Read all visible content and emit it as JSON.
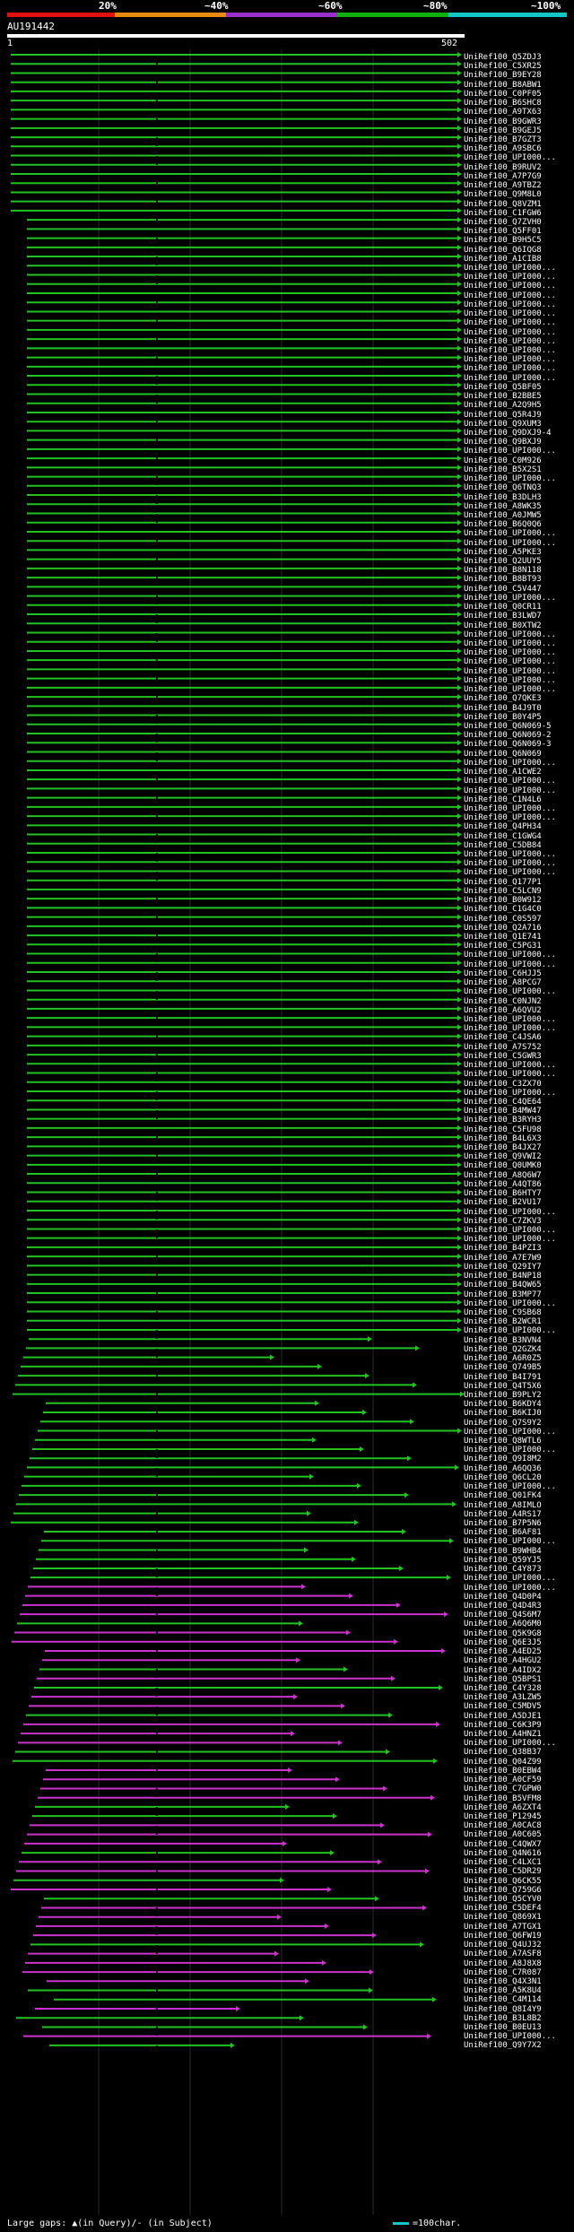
{
  "legend": {
    "ticks": [
      "20%",
      "~40%",
      "~60%",
      "~80%",
      "~100%"
    ],
    "colors": [
      "#e01010",
      "#e88a10",
      "#9930cc",
      "#11b011",
      "#12c6c6"
    ]
  },
  "query": {
    "name": "AU191442",
    "start": "1",
    "end": "502"
  },
  "colors": {
    "green": "#22c322",
    "magenta": "#cc33cc",
    "grid": "#2a2a2a",
    "centerline": "#000000"
  },
  "footer": {
    "gaps_text": "Large gaps: ▲(in Query)/- (in Subject)",
    "scale_text": "=100char."
  },
  "hits": [
    "UniRef100_Q5ZDJ3",
    "UniRef100_C5XR25",
    "UniRef100_B9EY28",
    "UniRef100_B8ABW1",
    "UniRef100_C0PF05",
    "UniRef100_B6SHC8",
    "UniRef100_A9TX63",
    "UniRef100_B9GWR3",
    "UniRef100_B9GEJ5",
    "UniRef100_B7GZT3",
    "UniRef100_A9SBC6",
    "UniRef100_UPI000...",
    "UniRef100_B9RUV2",
    "UniRef100_A7P7G9",
    "UniRef100_A9TBZ2",
    "UniRef100_Q9M8L0",
    "UniRef100_Q8VZM1",
    "UniRef100_C1FGW6",
    "UniRef100_Q7ZVH0",
    "UniRef100_Q5FF01",
    "UniRef100_B9H5C5",
    "UniRef100_Q6IQG8",
    "UniRef100_A1CIB8",
    "UniRef100_UPI000...",
    "UniRef100_UPI000...",
    "UniRef100_UPI000...",
    "UniRef100_UPI000...",
    "UniRef100_UPI000...",
    "UniRef100_UPI000...",
    "UniRef100_UPI000...",
    "UniRef100_UPI000...",
    "UniRef100_UPI000...",
    "UniRef100_UPI000...",
    "UniRef100_UPI000...",
    "UniRef100_UPI000...",
    "UniRef100_UPI000...",
    "UniRef100_Q5BF05",
    "UniRef100_B2BBE5",
    "UniRef100_A2Q9H5",
    "UniRef100_Q5R4J9",
    "UniRef100_Q9XUM3",
    "UniRef100_Q9DXJ9-4",
    "UniRef100_Q9BXJ9",
    "UniRef100_UPI000...",
    "UniRef100_C0M926",
    "UniRef100_B5X2S1",
    "UniRef100_UPI000...",
    "UniRef100_Q6TNQ3",
    "UniRef100_B3DLH3",
    "UniRef100_A8WK35",
    "UniRef100_A0JMW5",
    "UniRef100_B6Q0Q6",
    "UniRef100_UPI000...",
    "UniRef100_UPI000...",
    "UniRef100_A5PKE3",
    "UniRef100_Q2UUY5",
    "UniRef100_B8N118",
    "UniRef100_B8BT93",
    "UniRef100_C5V447",
    "UniRef100_UPI000...",
    "UniRef100_Q0CR11",
    "UniRef100_B3LWD7",
    "UniRef100_B0XTW2",
    "UniRef100_UPI000...",
    "UniRef100_UPI000...",
    "UniRef100_UPI000...",
    "UniRef100_UPI000...",
    "UniRef100_UPI000...",
    "UniRef100_UPI000...",
    "UniRef100_UPI000...",
    "UniRef100_Q7QKE3",
    "UniRef100_B4J9T0",
    "UniRef100_B0Y4P5",
    "UniRef100_Q6N069-5",
    "UniRef100_Q6N069-2",
    "UniRef100_Q6N069-3",
    "UniRef100_Q6N069",
    "UniRef100_UPI000...",
    "UniRef100_A1CWE2",
    "UniRef100_UPI000...",
    "UniRef100_UPI000...",
    "UniRef100_C1N4L6",
    "UniRef100_UPI000...",
    "UniRef100_UPI000...",
    "UniRef100_Q4PH34",
    "UniRef100_C1GWG4",
    "UniRef100_C5DB84",
    "UniRef100_UPI000...",
    "UniRef100_UPI000...",
    "UniRef100_UPI000...",
    "UniRef100_Q177P1",
    "UniRef100_C5LCN9",
    "UniRef100_B0W912",
    "UniRef100_C1G4C0",
    "UniRef100_C0S597",
    "UniRef100_Q2A716",
    "UniRef100_Q1E741",
    "UniRef100_C5PG31",
    "UniRef100_UPI000...",
    "UniRef100_UPI000...",
    "UniRef100_C6HJJ5",
    "UniRef100_A8PCG7",
    "UniRef100_UPI000...",
    "UniRef100_C0NJN2",
    "UniRef100_A6QVU2",
    "UniRef100_UPI000...",
    "UniRef100_UPI000...",
    "UniRef100_C4JSA6",
    "UniRef100_A7S752",
    "UniRef100_C5GWR3",
    "UniRef100_UPI000...",
    "UniRef100_UPI000...",
    "UniRef100_C3ZX70",
    "UniRef100_UPI000...",
    "UniRef100_C4QE64",
    "UniRef100_B4MW47",
    "UniRef100_B3RYH3",
    "UniRef100_C5FU98",
    "UniRef100_B4L6X3",
    "UniRef100_B4JX27",
    "UniRef100_Q9VWI2",
    "UniRef100_Q0UMK0",
    "UniRef100_A8Q6W7",
    "UniRef100_A4QT86",
    "UniRef100_B6HTY7",
    "UniRef100_B2VU17",
    "UniRef100_UPI000...",
    "UniRef100_C7ZKV3",
    "UniRef100_UPI000...",
    "UniRef100_UPI000...",
    "UniRef100_B4PZI3",
    "UniRef100_A7E7W9",
    "UniRef100_Q29IY7",
    "UniRef100_B4NP18",
    "UniRef100_B4QW65",
    "UniRef100_B3MP77",
    "UniRef100_UPI000...",
    "UniRef100_C9SB68",
    "UniRef100_B2WCR1",
    "UniRef100_UPI000...",
    "UniRef100_B3NVN4",
    "UniRef100_Q2GZK4",
    "UniRef100_A6R0Z5",
    "UniRef100_Q749B5",
    "UniRef100_B4I791",
    "UniRef100_Q4T5X6",
    "UniRef100_B9PLY2",
    "UniRef100_B6KDY4",
    "UniRef100_B6KIJ0",
    "UniRef100_Q7S9Y2",
    "UniRef100_UPI000...",
    "UniRef100_Q8WTL6",
    "UniRef100_UPI000...",
    "UniRef100_Q9I8M2",
    "UniRef100_A6QQ36",
    "UniRef100_Q6CL20",
    "UniRef100_UPI000...",
    "UniRef100_Q01FK4",
    "UniRef100_A8IMLO",
    "UniRef100_A4RS17",
    "UniRef100_B7P5N6",
    "UniRef100_B6AF81",
    "UniRef100_UPI000...",
    "UniRef100_B9WHB4",
    "UniRef100_Q59YJ5",
    "UniRef100_C4Y873",
    "UniRef100_UPI000...",
    "UniRef100_UPI000...",
    "UniRef100_Q4D0P4",
    "UniRef100_Q4D4R3",
    "UniRef100_Q4S6M7",
    "UniRef100_A6Q6M0",
    "UniRef100_Q5K9G8",
    "UniRef100_Q6E3J5",
    "UniRef100_A4ED25",
    "UniRef100_A4HGU2",
    "UniRef100_A4IDX2",
    "UniRef100_Q5BPS1",
    "UniRef100_C4Y328",
    "UniRef100_A3LZW5",
    "UniRef100_C5MDV5",
    "UniRef100_A5DJE1",
    "UniRef100_C6K3P9",
    "UniRef100_A4HNZ1",
    "UniRef100_UPI000...",
    "UniRef100_Q38B37",
    "UniRef100_Q04Z99",
    "UniRef100_B0EBW4",
    "UniRef100_A0CF59",
    "UniRef100_C7GPW0",
    "UniRef100_B5VFM8",
    "UniRef100_A6ZXT4",
    "UniRef100_P12945",
    "UniRef100_A0CAC8",
    "UniRef100_A0C605",
    "UniRef100_C4QWX7",
    "UniRef100_Q4N616",
    "UniRef100_C4LXC1",
    "UniRef100_C5DR29",
    "UniRef100_Q6CK55",
    "UniRef100_Q759G6",
    "UniRef100_Q5CYV0",
    "UniRef100_C5DEF4",
    "UniRef100_Q869X1",
    "UniRef100_A7TGX1",
    "UniRef100_Q6FW19",
    "UniRef100_Q4UJ32",
    "UniRef100_A7ASF8",
    "UniRef100_A8J8X8",
    "UniRef100_C7R087",
    "UniRef100_Q4X3N1",
    "UniRef100_A5K8U4",
    "UniRef100_C4M114",
    "UniRef100_Q8I4Y9",
    "UniRef100_B3L8B2",
    "UniRef100_B0EU13",
    "UniRef100_UPI000...",
    "UniRef100_Q9Y7X2"
  ]
}
